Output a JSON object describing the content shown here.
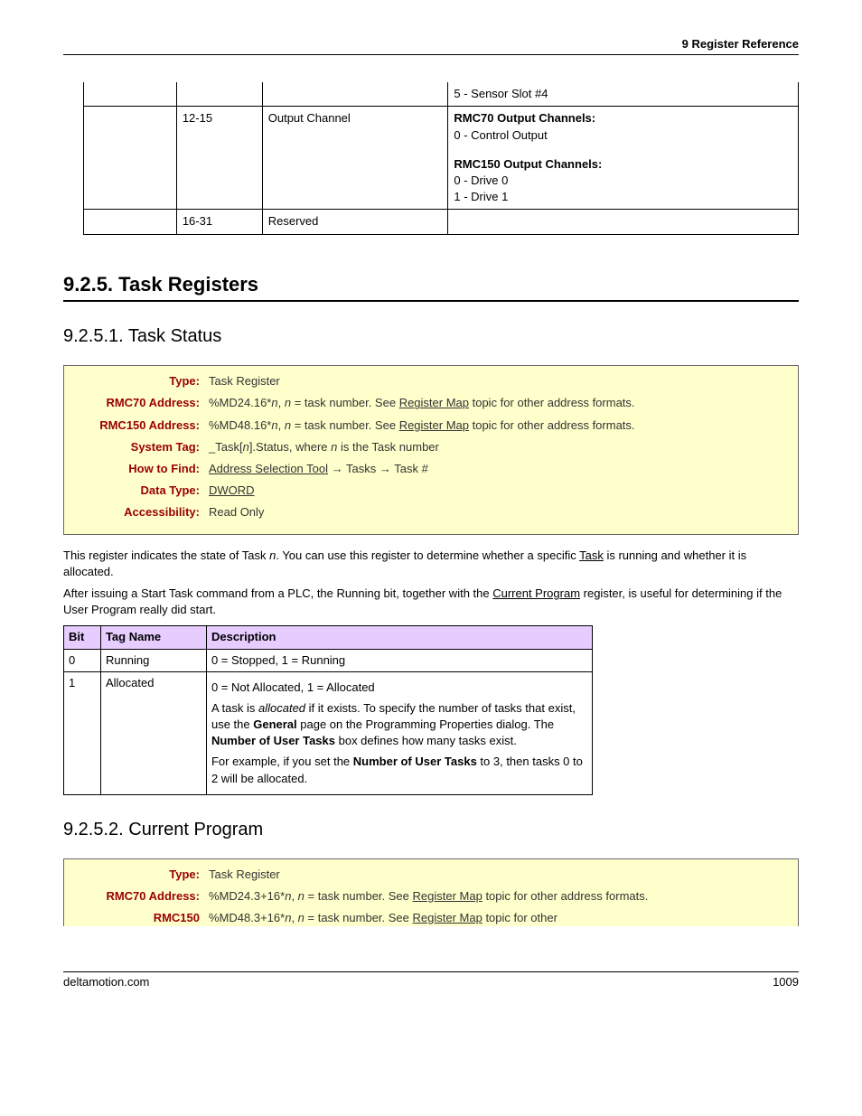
{
  "header": {
    "chapter": "9  Register Reference"
  },
  "footer": {
    "site": "deltamotion.com",
    "page": "1009"
  },
  "topTable": {
    "rows": [
      {
        "c0": "",
        "c1": "",
        "c2": "",
        "c3": "5 - Sensor Slot #4"
      },
      {
        "c0": "",
        "c1": "12-15",
        "c2": "Output Channel",
        "c3_h1": "RMC70 Output Channels:",
        "c3_l1": "0 - Control Output",
        "c3_h2": "RMC150 Output Channels:",
        "c3_l2a": "0 - Drive 0",
        "c3_l2b": "1 - Drive 1"
      },
      {
        "c0": "",
        "c1": "16-31",
        "c2": "Reserved",
        "c3": ""
      }
    ]
  },
  "section": {
    "num_title": "9.2.5. Task Registers"
  },
  "sub1": {
    "num_title": "9.2.5.1. Task Status",
    "info": {
      "type_l": "Type:",
      "type_v": "Task Register",
      "r70_l": "RMC70 Address:",
      "r70_prefix": "%MD24.16*",
      "r70_var": "n",
      "r70_mid": ", ",
      "r70_var2": "n",
      "r70_suffix": " = task number. See ",
      "r70_link": "Register Map",
      "r70_tail": " topic for other address formats.",
      "r150_l": "RMC150 Address:",
      "r150_prefix": "%MD48.16*",
      "r150_var": "n",
      "r150_mid": ", ",
      "r150_var2": "n",
      "r150_suffix": " = task number. See ",
      "r150_link": "Register Map",
      "r150_tail": " topic for other address formats.",
      "tag_l": "System Tag:",
      "tag_pre": "_Task[",
      "tag_var": "n",
      "tag_mid": "].Status, where ",
      "tag_var2": "n",
      "tag_tail": " is the Task number",
      "find_l": "How to Find:",
      "find_link": "Address Selection Tool",
      "find_arr1": " → Tasks → Task #",
      "dtype_l": "Data Type:",
      "dtype_link": "DWORD",
      "acc_l": "Accessibility:",
      "acc_v": "Read Only"
    },
    "para1_a": "This register indicates the state of Task ",
    "para1_var": "n",
    "para1_b": ". You can use this register to determine whether a specific ",
    "para1_link": "Task",
    "para1_c": " is running and whether it is allocated.",
    "para2_a": "After issuing a Start Task command from a PLC, the Running bit, together with the ",
    "para2_link": "Current Program",
    "para2_b": " register, is useful for determining if the User Program really did start.",
    "bitsHeader": {
      "bit": "Bit",
      "tag": "Tag Name",
      "desc": "Description"
    },
    "bits": [
      {
        "bit": "0",
        "tag": "Running",
        "desc": "0 = Stopped, 1 = Running"
      },
      {
        "bit": "1",
        "tag": "Allocated",
        "l1": "0 = Not Allocated, 1 = Allocated",
        "l2a": "A task is ",
        "l2i": "allocated",
        "l2b": " if it exists. To specify the number of tasks that exist, use the ",
        "l2s1": "General",
        "l2c": " page on the Programming Properties dialog. The ",
        "l2s2": "Number of User Tasks",
        "l2d": " box defines how many tasks exist.",
        "l3a": "For example, if you set the ",
        "l3s1": "Number of User Tasks",
        "l3b": " to 3, then tasks 0 to 2 will be allocated."
      }
    ]
  },
  "sub2": {
    "num_title": "9.2.5.2. Current Program",
    "info": {
      "type_l": "Type:",
      "type_v": "Task Register",
      "r70_l": "RMC70 Address:",
      "r70_prefix": "%MD24.3+16*",
      "r70_var": "n",
      "r70_mid": ", ",
      "r70_var2": "n",
      "r70_suffix": " = task number. See ",
      "r70_link": "Register Map",
      "r70_tail": " topic for other address formats.",
      "r150_l": "RMC150",
      "r150_prefix": "%MD48.3+16*",
      "r150_var": "n",
      "r150_mid": ", ",
      "r150_var2": "n",
      "r150_suffix": " = task number. See ",
      "r150_link": "Register Map",
      "r150_tail": " topic for other"
    }
  }
}
